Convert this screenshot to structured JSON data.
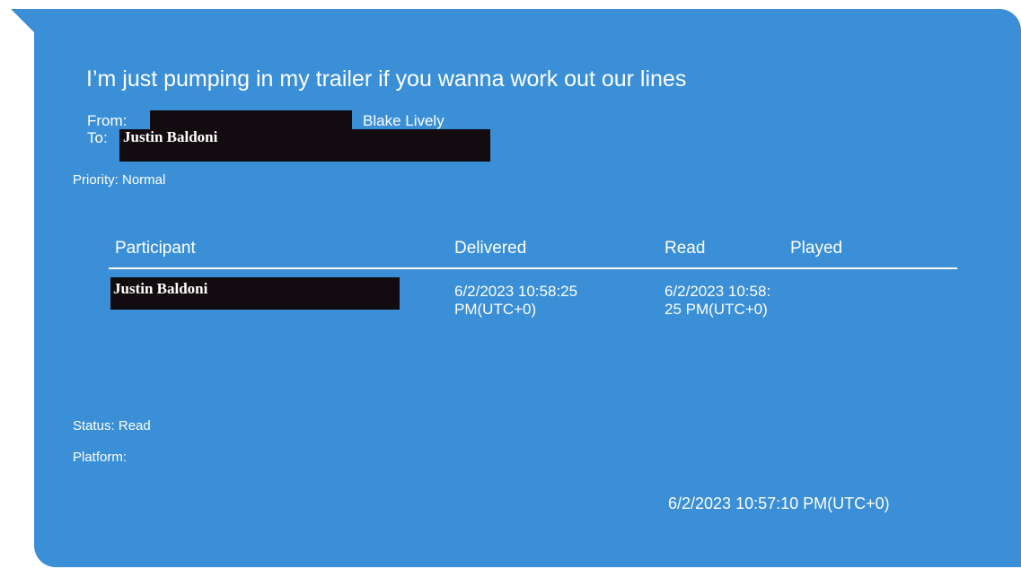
{
  "colors": {
    "bubble": "#3a8fd6",
    "text": "#ffffff",
    "redaction": "#120c10"
  },
  "message": {
    "text": "I’m just pumping in my trailer if you wanna work out our lines"
  },
  "from": {
    "label": "From:",
    "name": "Blake Lively"
  },
  "to": {
    "label": "To:",
    "name": "Justin Baldoni"
  },
  "priority": "Priority: Normal",
  "table": {
    "headers": {
      "participant": "Participant",
      "delivered": "Delivered",
      "read": "Read",
      "played": "Played"
    },
    "rows": [
      {
        "participant": "Justin Baldoni",
        "delivered": "6/2/2023 10:58:25 PM(UTC+0)",
        "read": "6/2/2023 10:58:25 PM(UTC+0)",
        "played": ""
      }
    ]
  },
  "status": "Status: Read",
  "platform": "Platform:",
  "timestamp": "6/2/2023 10:57:10 PM(UTC+0)"
}
